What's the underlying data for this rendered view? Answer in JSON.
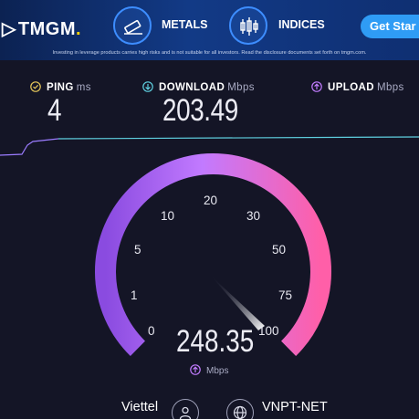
{
  "ad": {
    "brand": "TMGM",
    "brand_mark": "▷",
    "brand_dot": ".",
    "item1_label": "METALS",
    "item2_label": "INDICES",
    "cta_label": "Get Star",
    "disclaimer": "Investing in leverage products carries high risks and is not suitable for all investors. Read the disclosure documents set forth on tmgm.com."
  },
  "metrics": {
    "ping": {
      "label": "PING",
      "unit": "ms",
      "value": "4"
    },
    "download": {
      "label": "DOWNLOAD",
      "unit": "Mbps",
      "value": "203.49"
    },
    "upload": {
      "label": "UPLOAD",
      "unit": "Mbps",
      "value": ""
    }
  },
  "gauge": {
    "ticks": [
      "0",
      "1",
      "5",
      "10",
      "20",
      "30",
      "50",
      "75",
      "100"
    ],
    "current_value": "248.35",
    "unit": "Mbps"
  },
  "footer": {
    "isp": "Viettel",
    "server": "VNPT-NET"
  },
  "colors": {
    "background": "#141526",
    "accent_purple": "#9b7cff",
    "accent_cyan": "#5fd0e0",
    "gauge_start": "#8a4be0",
    "gauge_end": "#ff5fa8"
  }
}
